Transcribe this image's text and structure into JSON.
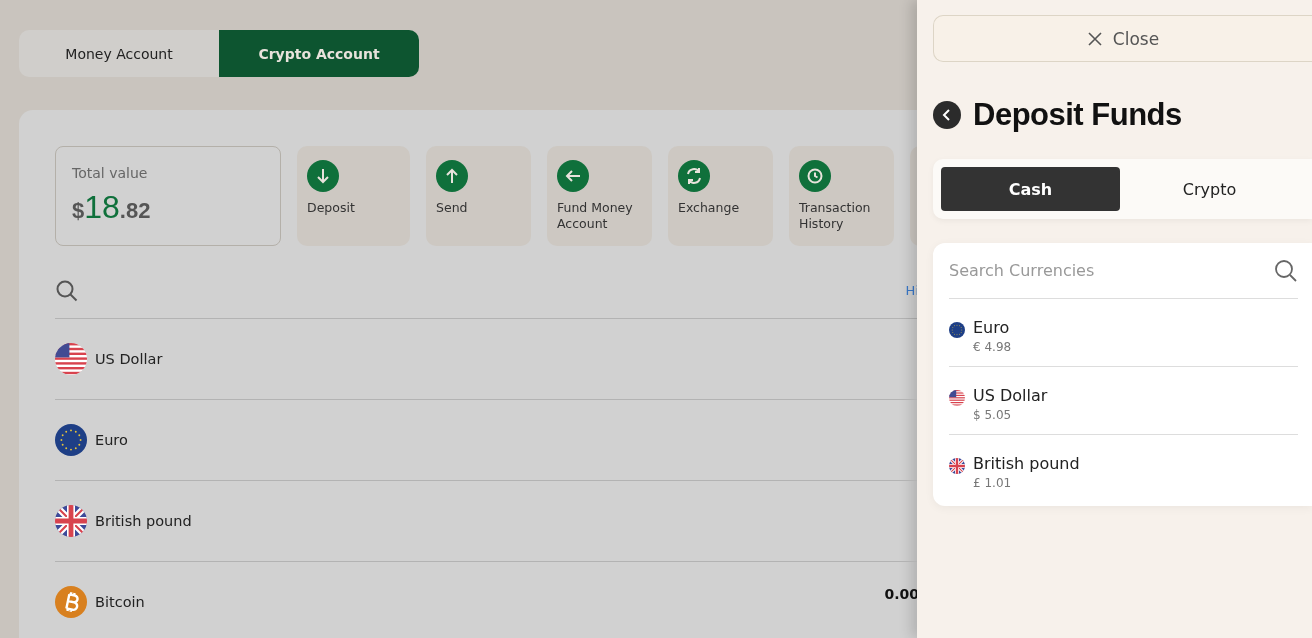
{
  "account_tabs": [
    {
      "label": "Money Account",
      "selected": false
    },
    {
      "label": "Crypto Account",
      "selected": true
    }
  ],
  "total": {
    "label": "Total value",
    "currency": "$",
    "whole": "18",
    "fraction": ".82"
  },
  "actions": [
    {
      "label": "Deposit",
      "kind": "down"
    },
    {
      "label": "Send",
      "kind": "up"
    },
    {
      "label": "Fund Money Account",
      "kind": "left"
    },
    {
      "label": "Exchange",
      "kind": "exchange"
    },
    {
      "label": "Transaction History",
      "kind": "clock"
    }
  ],
  "hide_link": "Hi",
  "assets": [
    {
      "name": "US Dollar",
      "kind": "us"
    },
    {
      "name": "Euro",
      "kind": "eu"
    },
    {
      "name": "British pound",
      "kind": "gb"
    },
    {
      "name": "Bitcoin",
      "kind": "btc",
      "balance": "0.00"
    }
  ],
  "drawer": {
    "close": "Close",
    "title": "Deposit Funds",
    "tabs": [
      {
        "label": "Cash",
        "selected": true
      },
      {
        "label": "Crypto",
        "selected": false
      }
    ],
    "search": {
      "placeholder": "Search Currencies"
    },
    "currencies": [
      {
        "name": "Euro",
        "amount": "€ 4.98",
        "kind": "eu"
      },
      {
        "name": "US Dollar",
        "amount": "$ 5.05",
        "kind": "us"
      },
      {
        "name": "British pound",
        "amount": "£ 1.01",
        "kind": "gb"
      }
    ]
  }
}
